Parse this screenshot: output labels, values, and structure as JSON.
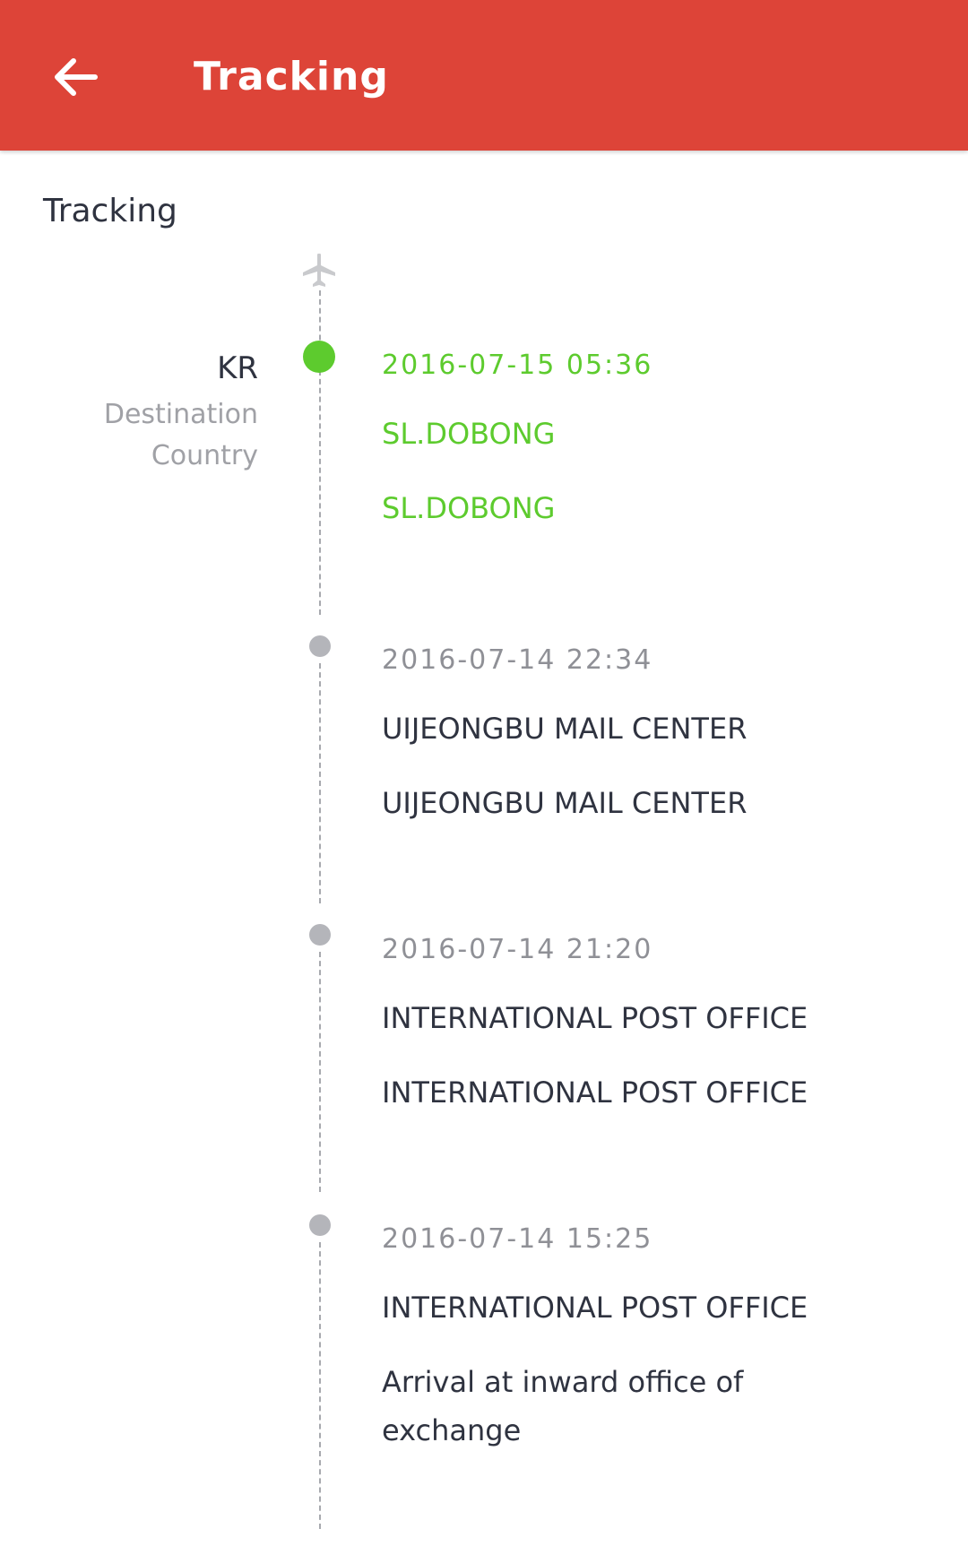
{
  "appbar": {
    "title": "Tracking"
  },
  "section": {
    "title": "Tracking"
  },
  "origin": {
    "code": "KR",
    "label": "Destination Country"
  },
  "icons": {
    "back": "arrow-left-icon",
    "plane": "airplane-icon"
  },
  "colors": {
    "appbar": "#dd4438",
    "active": "#5dcb2e",
    "inactive_dot": "#b4b5ba",
    "text": "#2f3340",
    "muted": "#8f9096"
  },
  "events": [
    {
      "time": "2016-07-15 05:36",
      "location": "SL.DOBONG",
      "description": "SL.DOBONG",
      "active": true
    },
    {
      "time": "2016-07-14 22:34",
      "location": "UIJEONGBU MAIL CENTER",
      "description": "UIJEONGBU MAIL CENTER",
      "active": false
    },
    {
      "time": "2016-07-14 21:20",
      "location": "INTERNATIONAL POST OFFICE",
      "description": "INTERNATIONAL POST OFFICE",
      "active": false
    },
    {
      "time": "2016-07-14 15:25",
      "location": "INTERNATIONAL POST OFFICE",
      "description": "Arrival at inward office of exchange",
      "active": false
    }
  ]
}
